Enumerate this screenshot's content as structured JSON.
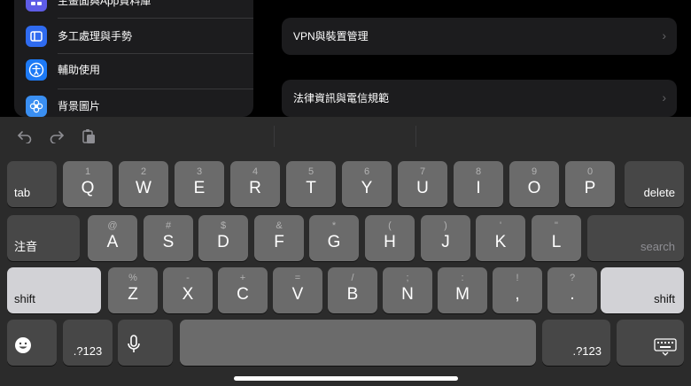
{
  "sidebar": {
    "items": [
      {
        "label": "主畫面與App資料庫",
        "icon": "home-screen-icon",
        "color": "#5e5ce6"
      },
      {
        "label": "多工處理與手勢",
        "icon": "multitasking-icon",
        "color": "#2f6bf0"
      },
      {
        "label": "輔助使用",
        "icon": "accessibility-icon",
        "color": "#1d7af5"
      },
      {
        "label": "背景圖片",
        "icon": "wallpaper-icon",
        "color": "#3a8ff2"
      }
    ]
  },
  "detail": {
    "vpn_label": "VPN與裝置管理",
    "legal_label": "法律資訊與電信規範",
    "chevron": "›"
  },
  "keyboard": {
    "toolbar": [
      "undo-icon",
      "redo-icon",
      "paste-icon"
    ],
    "rows": [
      [
        {
          "main": "Q",
          "sub": "1"
        },
        {
          "main": "W",
          "sub": "2"
        },
        {
          "main": "E",
          "sub": "3"
        },
        {
          "main": "R",
          "sub": "4"
        },
        {
          "main": "T",
          "sub": "5"
        },
        {
          "main": "Y",
          "sub": "6"
        },
        {
          "main": "U",
          "sub": "7"
        },
        {
          "main": "I",
          "sub": "8"
        },
        {
          "main": "O",
          "sub": "9"
        },
        {
          "main": "P",
          "sub": "0"
        }
      ],
      [
        {
          "main": "A",
          "sub": "@"
        },
        {
          "main": "S",
          "sub": "#"
        },
        {
          "main": "D",
          "sub": "$"
        },
        {
          "main": "F",
          "sub": "&"
        },
        {
          "main": "G",
          "sub": "*"
        },
        {
          "main": "H",
          "sub": "("
        },
        {
          "main": "J",
          "sub": ")"
        },
        {
          "main": "K",
          "sub": "'"
        },
        {
          "main": "L",
          "sub": "\""
        }
      ],
      [
        {
          "main": "Z",
          "sub": "%"
        },
        {
          "main": "X",
          "sub": "-"
        },
        {
          "main": "C",
          "sub": "+"
        },
        {
          "main": "V",
          "sub": "="
        },
        {
          "main": "B",
          "sub": "/"
        },
        {
          "main": "N",
          "sub": ";"
        },
        {
          "main": "M",
          "sub": ":"
        },
        {
          "main": ",",
          "sub": "!"
        },
        {
          "main": ".",
          "sub": "?"
        }
      ]
    ],
    "tab_label": "tab",
    "delete_label": "delete",
    "zhuyin_label": "注音",
    "search_label": "search",
    "shift_label": "shift",
    "numbers_label": ".?123",
    "emoji_icon": "emoji-icon",
    "mic_icon": "microphone-icon",
    "dismiss_icon": "keyboard-dismiss-icon"
  }
}
